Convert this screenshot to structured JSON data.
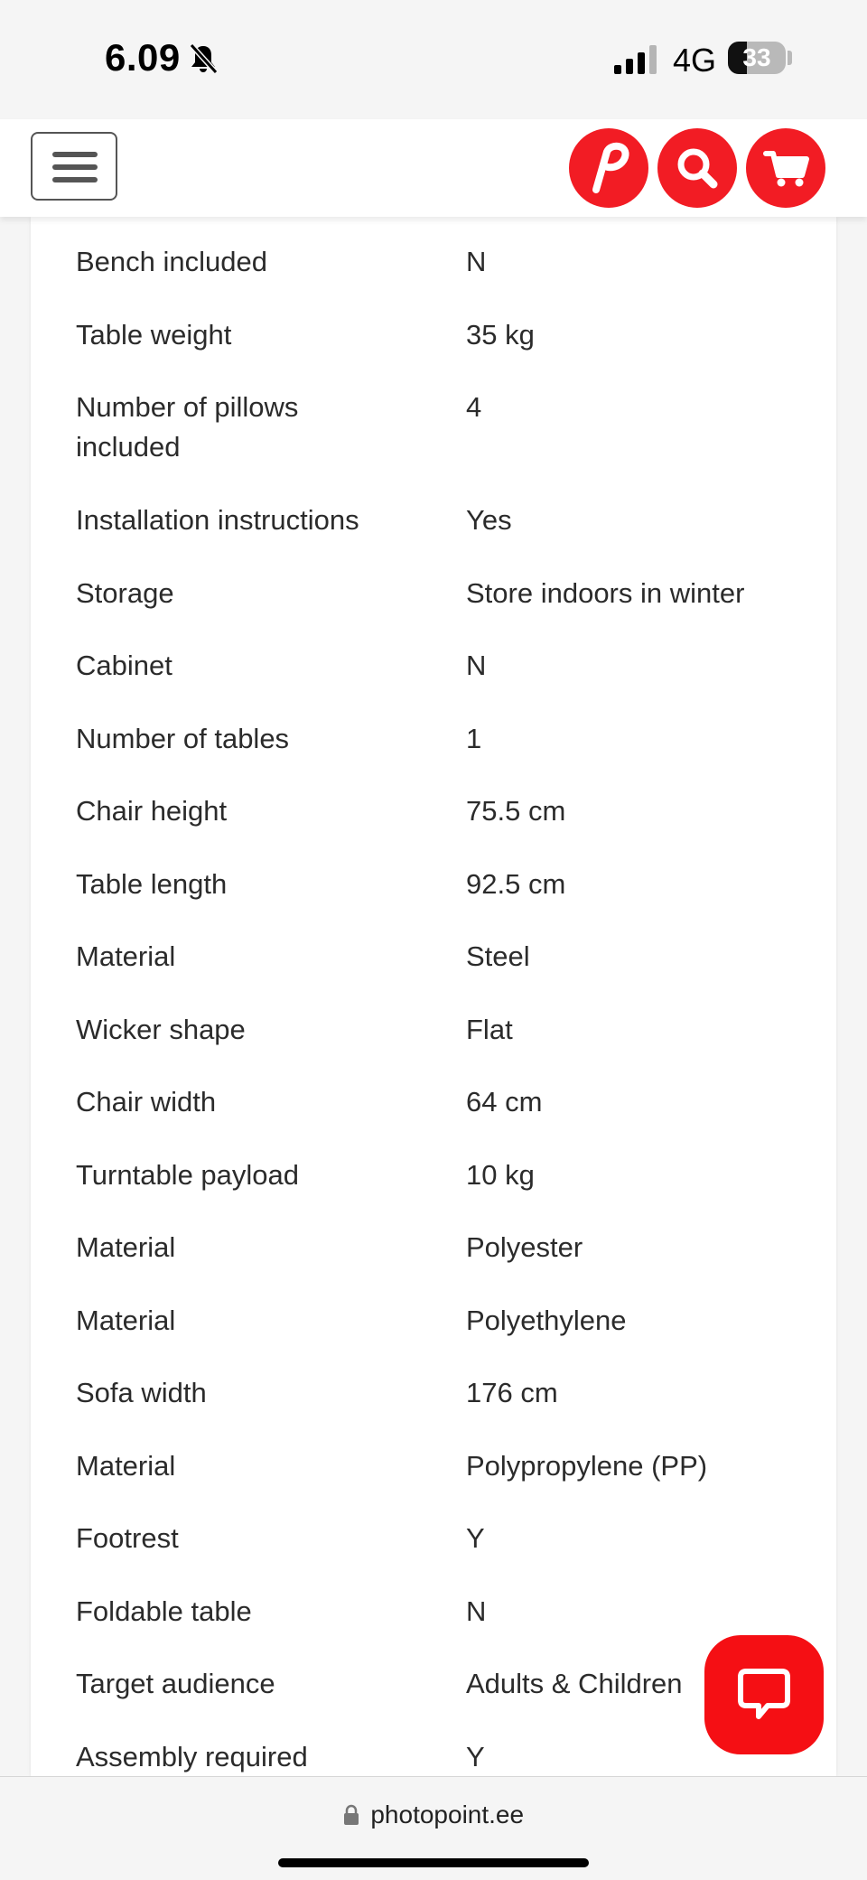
{
  "status_bar": {
    "time": "6.09",
    "network": "4G",
    "battery": "33",
    "battery_level": 0.33
  },
  "header": {
    "menu_icon": "hamburger-menu-icon",
    "buttons": [
      {
        "name": "brand-logo-button",
        "icon": "photopoint-p-logo-icon"
      },
      {
        "name": "search-button",
        "icon": "search-icon"
      },
      {
        "name": "cart-button",
        "icon": "cart-icon"
      }
    ],
    "accent_color": "#f21c24"
  },
  "specs": [
    {
      "name": "Bench included",
      "value": "N"
    },
    {
      "name": "Table weight",
      "value": "35 kg"
    },
    {
      "name": "Number of pillows included",
      "value": "4"
    },
    {
      "name": "Installation instructions",
      "value": "Yes"
    },
    {
      "name": "Storage",
      "value": "Store indoors in winter"
    },
    {
      "name": "Cabinet",
      "value": "N"
    },
    {
      "name": "Number of tables",
      "value": "1"
    },
    {
      "name": "Chair height",
      "value": "75.5 cm"
    },
    {
      "name": "Table length",
      "value": "92.5 cm"
    },
    {
      "name": "Material",
      "value": "Steel"
    },
    {
      "name": "Wicker shape",
      "value": "Flat"
    },
    {
      "name": "Chair width",
      "value": "64 cm"
    },
    {
      "name": "Turntable payload",
      "value": "10 kg"
    },
    {
      "name": "Material",
      "value": "Polyester"
    },
    {
      "name": "Material",
      "value": "Polyethylene"
    },
    {
      "name": "Sofa width",
      "value": "176 cm"
    },
    {
      "name": "Material",
      "value": "Polypropylene (PP)"
    },
    {
      "name": "Footrest",
      "value": "Y"
    },
    {
      "name": "Foldable table",
      "value": "N"
    },
    {
      "name": "Target audience",
      "value": "Adults & Children"
    },
    {
      "name": "Assembly required",
      "value": "Y"
    }
  ],
  "chat": {
    "icon": "chat-bubble-icon"
  },
  "browser": {
    "url": "photopoint.ee",
    "lock_icon": "lock-icon"
  }
}
